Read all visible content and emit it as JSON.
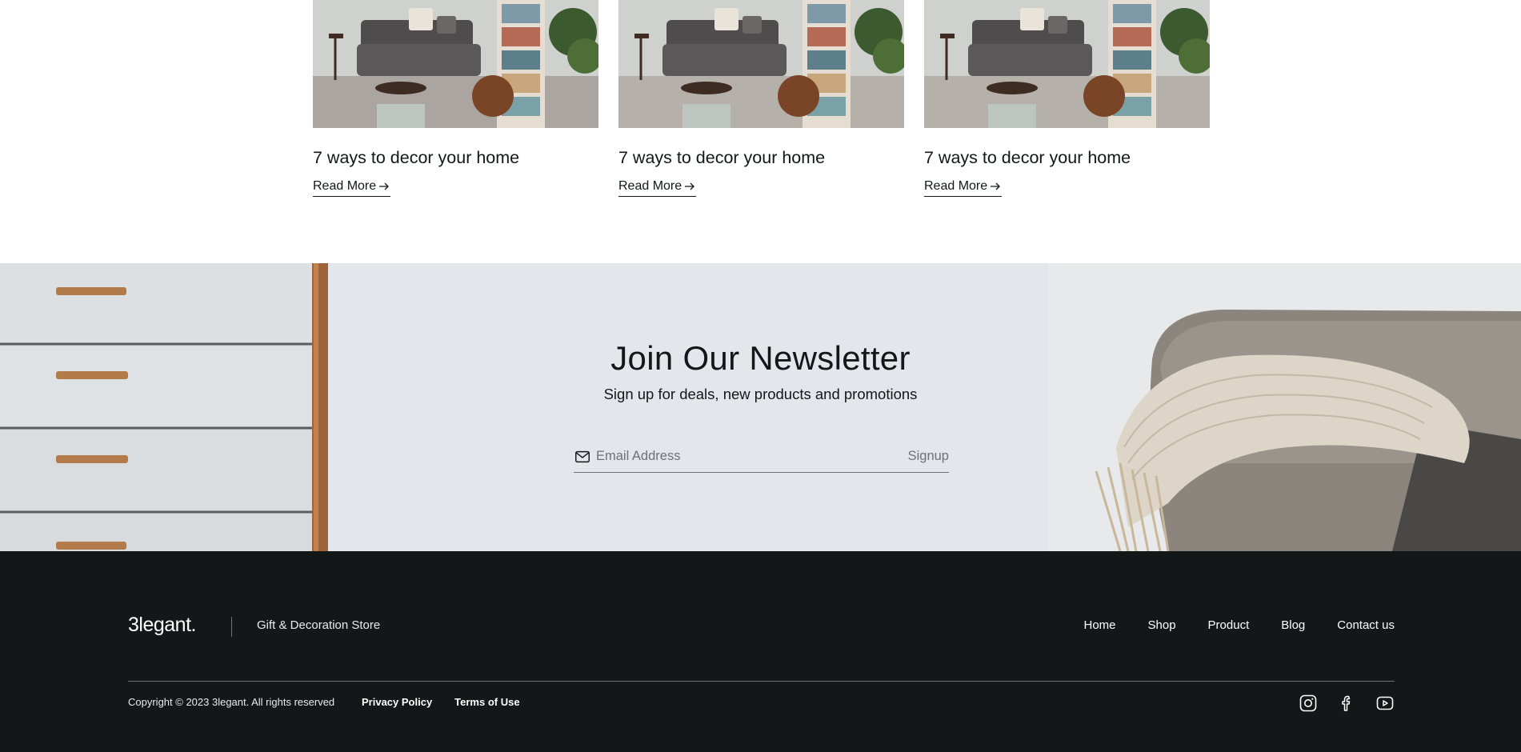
{
  "blog": {
    "cards": [
      {
        "title": "7 ways to decor your home",
        "read_more": "Read More"
      },
      {
        "title": "7 ways to decor your home",
        "read_more": "Read More"
      },
      {
        "title": "7 ways to decor your home",
        "read_more": "Read More"
      }
    ]
  },
  "newsletter": {
    "heading": "Join Our Newsletter",
    "subheading": "Sign up for deals, new products and promotions",
    "email_placeholder": "Email Address",
    "signup_label": "Signup"
  },
  "footer": {
    "logo": "3legant.",
    "tagline": "Gift & Decoration Store",
    "nav": [
      "Home",
      "Shop",
      "Product",
      "Blog",
      "Contact us"
    ],
    "copyright": "Copyright © 2023 3legant. All rights reserved",
    "privacy": "Privacy Policy",
    "terms": "Terms of Use",
    "socials": [
      "instagram-icon",
      "facebook-icon",
      "youtube-icon"
    ]
  },
  "colors": {
    "footer_bg": "#141718",
    "newsletter_bg": "#e3e6ea",
    "text_dark": "#141718",
    "text_muted": "#6c7275"
  }
}
